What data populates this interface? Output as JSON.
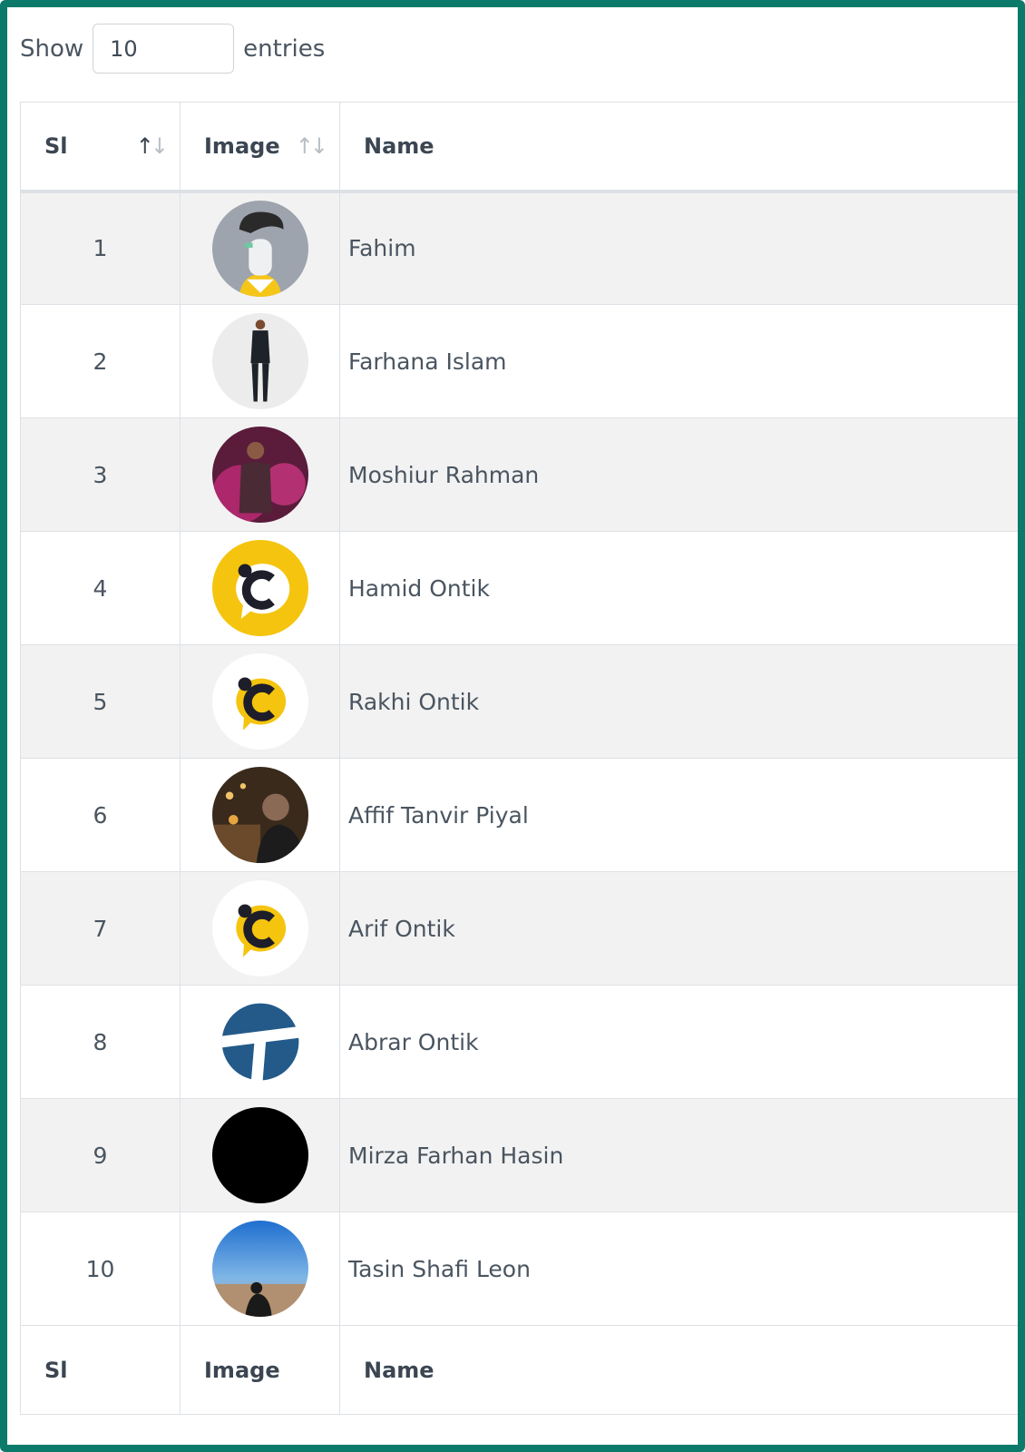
{
  "length_control": {
    "show_label": "Show",
    "value": "10",
    "entries_label": "entries"
  },
  "columns": {
    "sl": "Sl",
    "image": "Image",
    "name": "Name"
  },
  "rows": [
    {
      "sl": "1",
      "name": "Fahim",
      "avatar": "illustrated-man-avatar"
    },
    {
      "sl": "2",
      "name": "Farhana Islam",
      "avatar": "woman-in-suit-photo"
    },
    {
      "sl": "3",
      "name": "Moshiur Rahman",
      "avatar": "man-pink-night-photo"
    },
    {
      "sl": "4",
      "name": "Hamid Ontik",
      "avatar": "yellow-c-logo"
    },
    {
      "sl": "5",
      "name": "Rakhi Ontik",
      "avatar": "white-c-logo"
    },
    {
      "sl": "6",
      "name": "Affif Tanvir Piyal",
      "avatar": "man-night-lights-photo"
    },
    {
      "sl": "7",
      "name": "Arif Ontik",
      "avatar": "white-c-logo"
    },
    {
      "sl": "8",
      "name": "Abrar Ontik",
      "avatar": "blue-t-logo"
    },
    {
      "sl": "9",
      "name": "Mirza Farhan Hasin",
      "avatar": "black-circle"
    },
    {
      "sl": "10",
      "name": "Tasin Shafi Leon",
      "avatar": "beach-sky-photo"
    }
  ],
  "colors": {
    "frame_border": "#0c7a6a",
    "striped_row": "#f2f2f2",
    "text": "#4a5560"
  }
}
